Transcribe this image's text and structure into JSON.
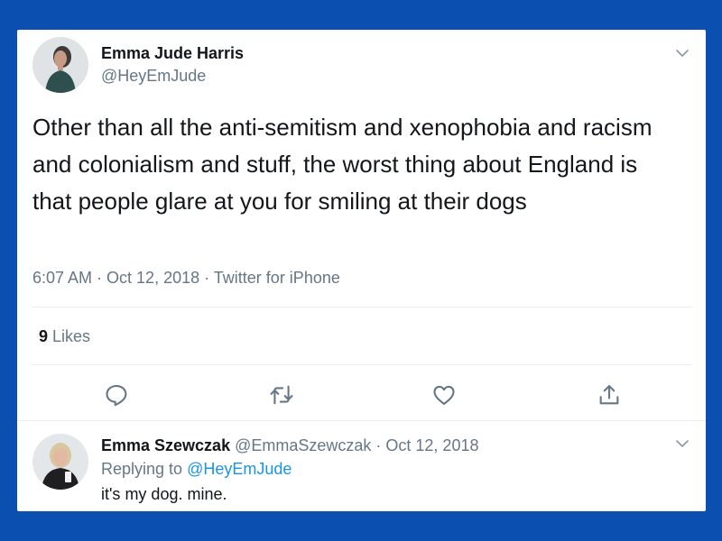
{
  "tweet": {
    "author_name": "Emma Jude Harris",
    "author_handle": "@HeyEmJude",
    "text": "Other than all the anti-semitism and xenophobia and racism and colonialism and stuff, the worst thing about England is that people glare at you for smiling at their dogs",
    "time": "6:07 AM",
    "date": "Oct 12, 2018",
    "source": "Twitter for iPhone",
    "separator": " · ",
    "likes_count": "9",
    "likes_label": "Likes",
    "actions": [
      "reply-icon",
      "retweet-icon",
      "like-icon",
      "share-icon"
    ]
  },
  "reply": {
    "author_name": "Emma Szewczak",
    "author_handle": "@EmmaSzewczak",
    "date": "Oct 12, 2018",
    "replying_label": "Replying to",
    "replying_to": "@HeyEmJude",
    "text": "it's my dog. mine."
  },
  "colors": {
    "background": "#0b4fb0",
    "text": "#14171a",
    "secondary": "#657786",
    "link": "#1b95e0",
    "divider": "#e6ecf0"
  }
}
